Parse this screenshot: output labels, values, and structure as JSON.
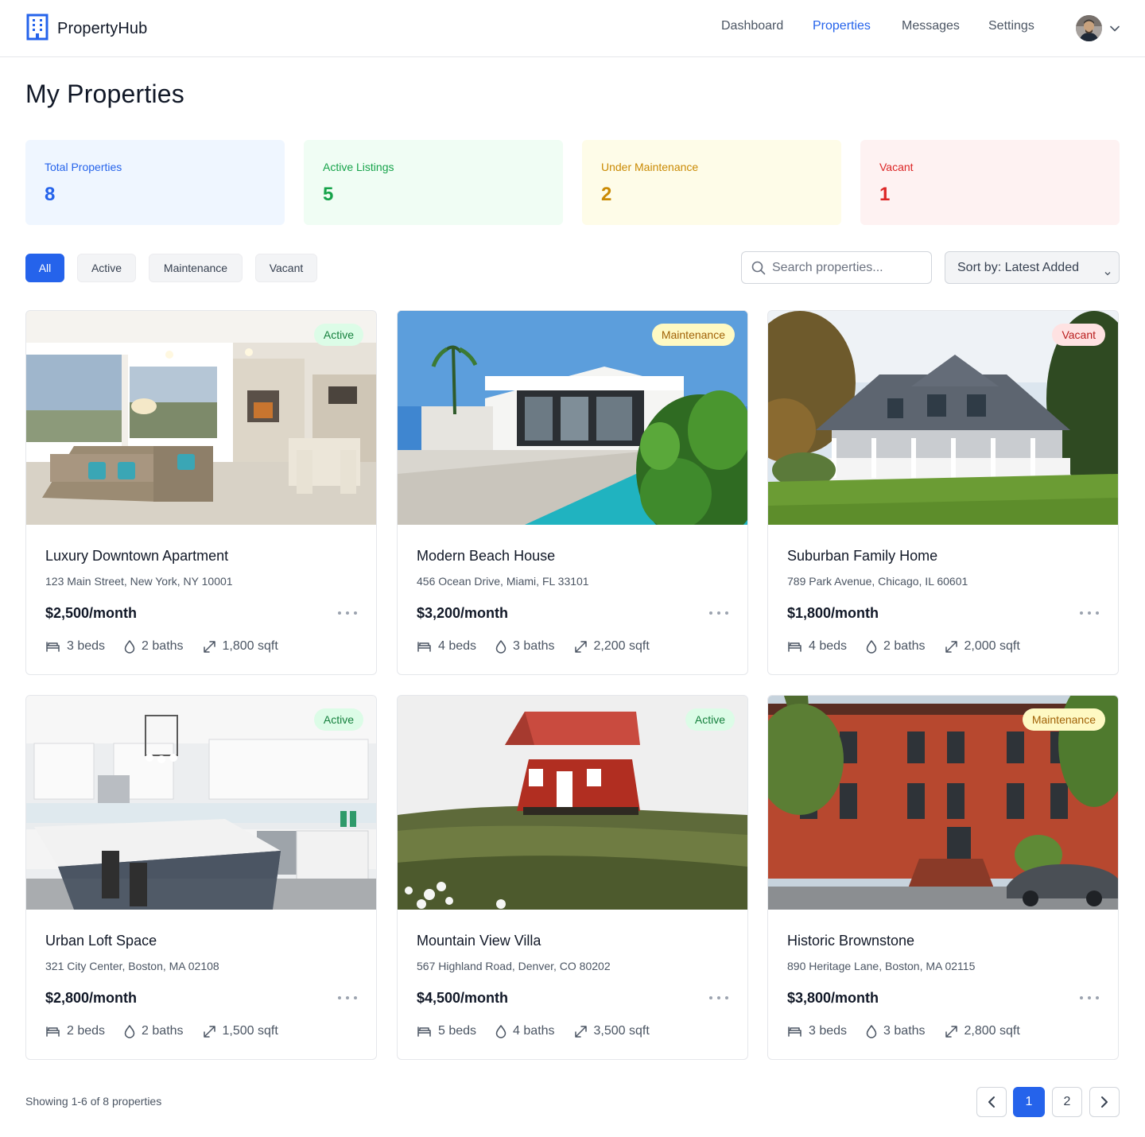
{
  "app": {
    "name": "PropertyHub"
  },
  "nav": {
    "items": [
      "Dashboard",
      "Properties",
      "Messages",
      "Settings"
    ],
    "active": "Properties"
  },
  "page": {
    "title": "My Properties"
  },
  "stats": [
    {
      "label": "Total Properties",
      "value": "8",
      "color": "#2563eb",
      "bg": "#eff6ff"
    },
    {
      "label": "Active Listings",
      "value": "5",
      "color": "#16a34a",
      "bg": "#f0fdf4"
    },
    {
      "label": "Under Maintenance",
      "value": "2",
      "color": "#ca8a04",
      "bg": "#fefce8"
    },
    {
      "label": "Vacant",
      "value": "1",
      "color": "#dc2626",
      "bg": "#fef2f2"
    }
  ],
  "filters": {
    "items": [
      "All",
      "Active",
      "Maintenance",
      "Vacant"
    ],
    "selected": "All"
  },
  "search": {
    "placeholder": "Search properties...",
    "value": ""
  },
  "sort": {
    "label": "Sort by: Latest Added"
  },
  "properties": [
    {
      "title": "Luxury Downtown Apartment",
      "address": "123 Main Street, New York, NY 10001",
      "price": "$2,500/month",
      "status": "Active",
      "beds": "3 beds",
      "baths": "2 baths",
      "sqft": "1,800 sqft",
      "image": "living-room-photo"
    },
    {
      "title": "Modern Beach House",
      "address": "456 Ocean Drive, Miami, FL 33101",
      "price": "$3,200/month",
      "status": "Maintenance",
      "beds": "4 beds",
      "baths": "3 baths",
      "sqft": "2,200 sqft",
      "image": "modern-house-pool-photo"
    },
    {
      "title": "Suburban Family Home",
      "address": "789 Park Avenue, Chicago, IL 60601",
      "price": "$1,800/month",
      "status": "Vacant",
      "beds": "4 beds",
      "baths": "2 baths",
      "sqft": "2,000 sqft",
      "image": "suburban-house-photo"
    },
    {
      "title": "Urban Loft Space",
      "address": "321 City Center, Boston, MA 02108",
      "price": "$2,800/month",
      "status": "Active",
      "beds": "2 beds",
      "baths": "2 baths",
      "sqft": "1,500 sqft",
      "image": "kitchen-photo"
    },
    {
      "title": "Mountain View Villa",
      "address": "567 Highland Road, Denver, CO 80202",
      "price": "$4,500/month",
      "status": "Active",
      "beds": "5 beds",
      "baths": "4 baths",
      "sqft": "3,500 sqft",
      "image": "red-cabin-photo"
    },
    {
      "title": "Historic Brownstone",
      "address": "890 Heritage Lane, Boston, MA 02115",
      "price": "$3,800/month",
      "status": "Maintenance",
      "beds": "3 beds",
      "baths": "3 baths",
      "sqft": "2,800 sqft",
      "image": "brownstone-photo"
    }
  ],
  "pagination": {
    "summary": "Showing 1-6 of 8 properties",
    "pages": [
      "1",
      "2"
    ],
    "current": "1"
  },
  "icons": {
    "logo": "building-icon",
    "user": "avatar",
    "menu": "chevron-down-icon",
    "search": "search-icon",
    "beds": "bed-icon",
    "baths": "droplet-icon",
    "sqft": "expand-arrows-icon",
    "more": "ellipsis-icon",
    "prev": "chevron-left-icon",
    "next": "chevron-right-icon"
  },
  "colors": {
    "primary": "#2563eb",
    "border": "#e5e7eb",
    "text": "#111827",
    "muted": "#4b5563"
  }
}
